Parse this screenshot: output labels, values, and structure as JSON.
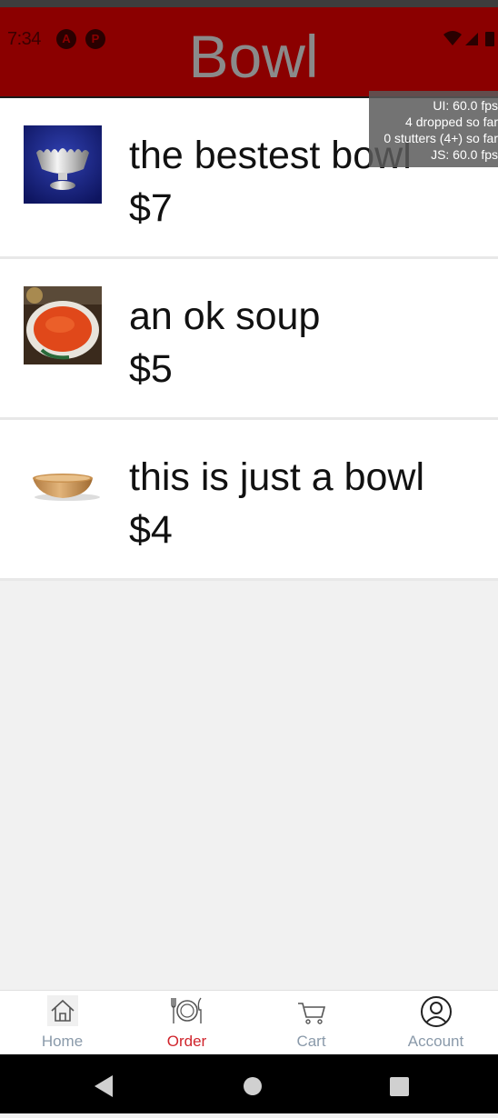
{
  "status": {
    "time": "7:34",
    "badges": [
      "A",
      "P"
    ]
  },
  "header": {
    "title": "Bowl"
  },
  "perf_overlay": {
    "lines": [
      "UI: 60.0 fps",
      "4 dropped so far",
      "0 stutters (4+) so far",
      "JS: 60.0 fps"
    ]
  },
  "products": [
    {
      "name": "the bestest bowl",
      "price": "$7",
      "image": "silver-footed-bowl"
    },
    {
      "name": "an ok soup",
      "price": "$5",
      "image": "tomato-soup-bowl"
    },
    {
      "name": "this is just a bowl",
      "price": "$4",
      "image": "wooden-bowl"
    }
  ],
  "tabs": [
    {
      "label": "Home",
      "icon": "home-icon",
      "active": false
    },
    {
      "label": "Order",
      "icon": "plate-cutlery-icon",
      "active": true
    },
    {
      "label": "Cart",
      "icon": "cart-icon",
      "active": false
    },
    {
      "label": "Account",
      "icon": "account-icon",
      "active": false
    }
  ],
  "colors": {
    "header_bg": "#8b0000",
    "title_text": "#8a8a8a",
    "active_tab": "#d0242c",
    "inactive_tab": "#8a9aaa"
  }
}
